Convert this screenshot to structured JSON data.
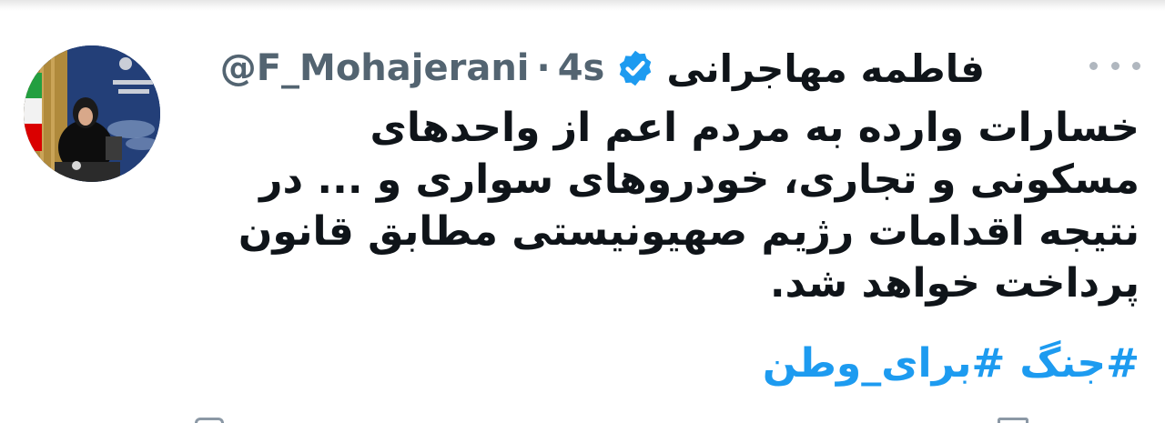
{
  "tweet": {
    "display_name": "فاطمه مهاجرانی",
    "handle": "@F_Mohajerani",
    "separator": "·",
    "timestamp": "4s",
    "verified": true,
    "body_lines": [
      "خسارات وارده به مردم اعم از واحدهای",
      "مسکونی و تجاری، خودروهای سواری و ... در",
      "نتیجه اقدامات رژیم صهیونیستی مطابق قانون",
      "پرداخت خواهد شد."
    ],
    "hashtags": [
      "#جنگ",
      "#برای_وطن"
    ]
  },
  "icons": {
    "verified": "verified-badge-icon",
    "more": "more-options-icon",
    "avatar": "profile-avatar"
  },
  "colors": {
    "hashtag": "#1d9bf0",
    "verified": "#1d9bf0",
    "handle": "#536471",
    "text": "#0f1419"
  }
}
